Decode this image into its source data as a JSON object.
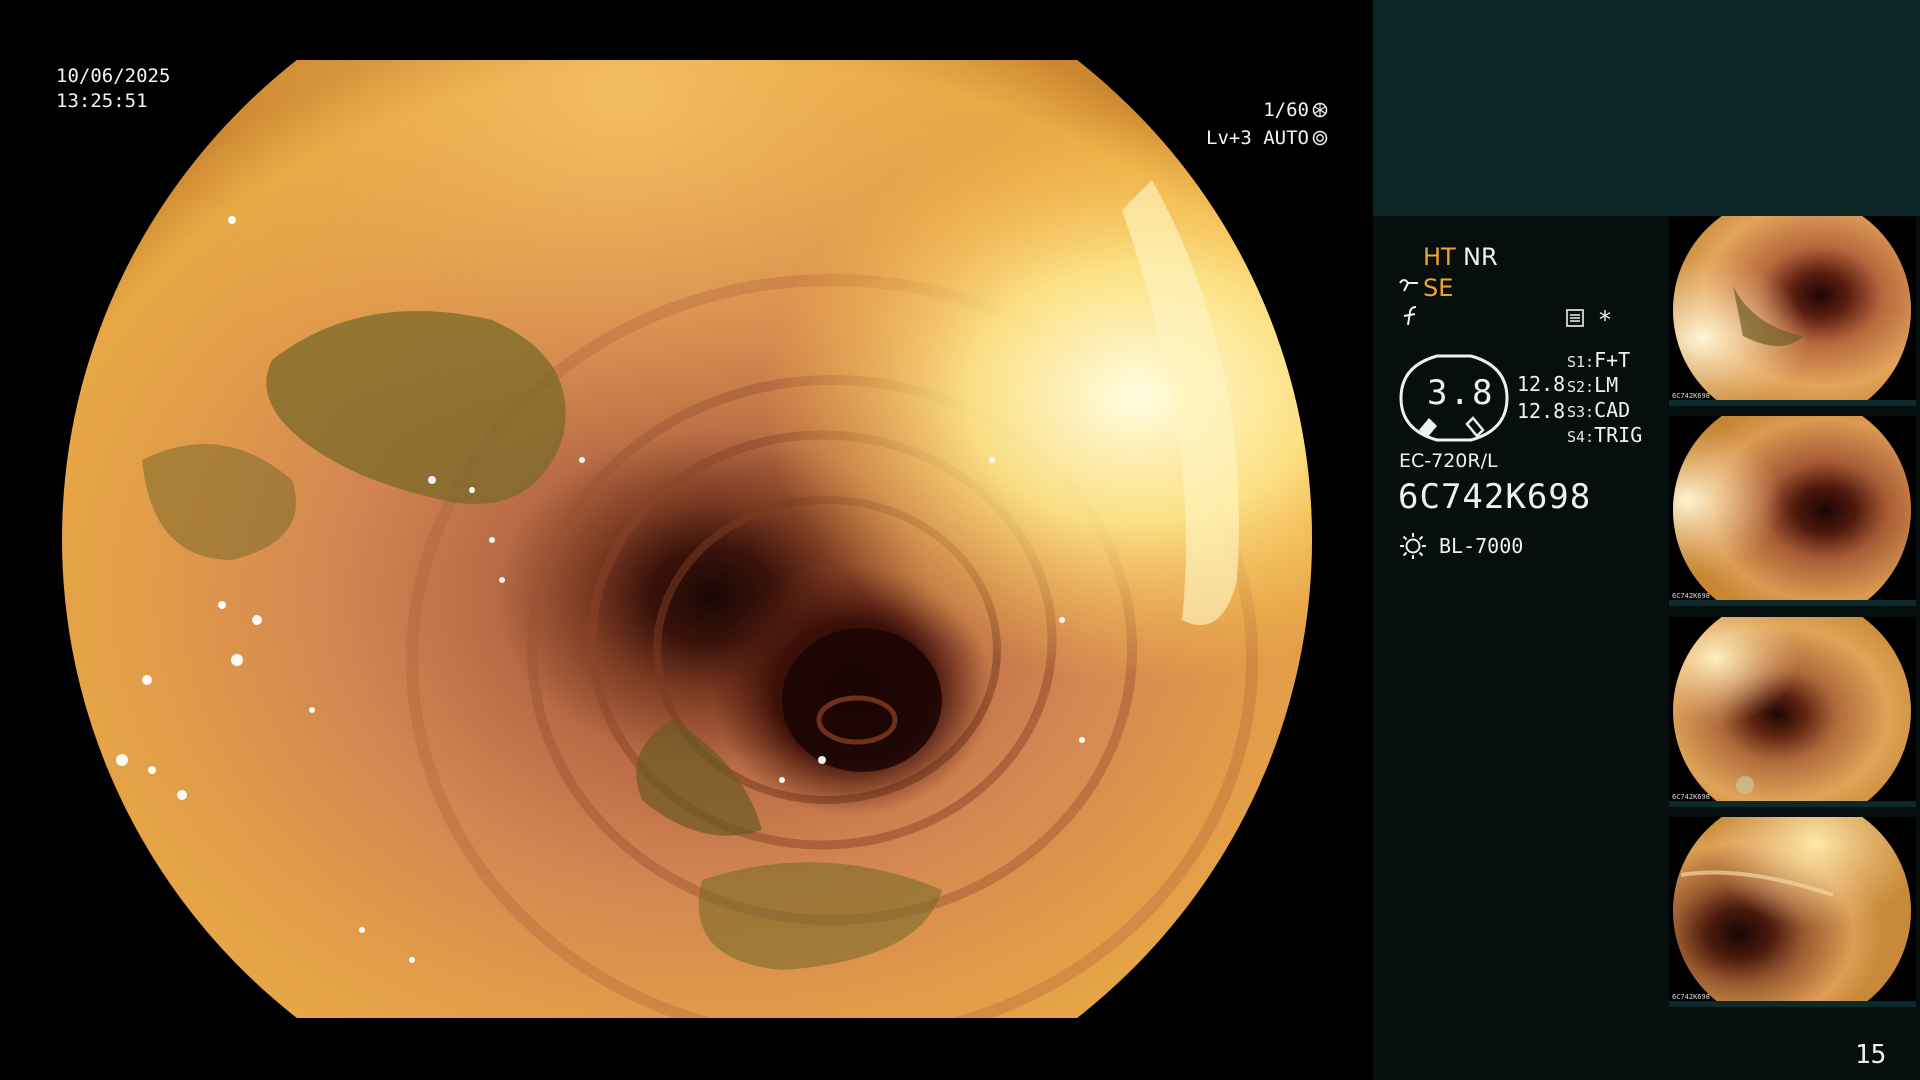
{
  "osd": {
    "date": "10/06/2025",
    "time": "13:25:51",
    "shutter": "1/60",
    "shutter_icon": "shutter-icon",
    "level": "Lv+3 AUTO",
    "iris_icon": "iris-icon"
  },
  "panel": {
    "background_color": "#060e0e",
    "top_band_color": "#0c2525",
    "accent_color": "#f3a430",
    "modes": {
      "ht": "HT",
      "nr": "NR",
      "se": "SE"
    },
    "gauge_value": "3.8",
    "numbers": [
      "12.8",
      "12.8"
    ],
    "switches": [
      {
        "key": "S1:",
        "value": "F+T"
      },
      {
        "key": "S2:",
        "value": "LM"
      },
      {
        "key": "S3:",
        "value": "CAD"
      },
      {
        "key": "S4:",
        "value": "TRIG"
      }
    ],
    "star": "*",
    "scope_model": "EC-720R/L",
    "scope_serial": "6C742K698",
    "light_source": "BL-7000",
    "page_number": "15"
  },
  "thumbnails": [
    {
      "label": "6C742K698"
    },
    {
      "label": "6C742K698"
    },
    {
      "label": "6C742K698"
    },
    {
      "label": "6C742K698"
    }
  ]
}
